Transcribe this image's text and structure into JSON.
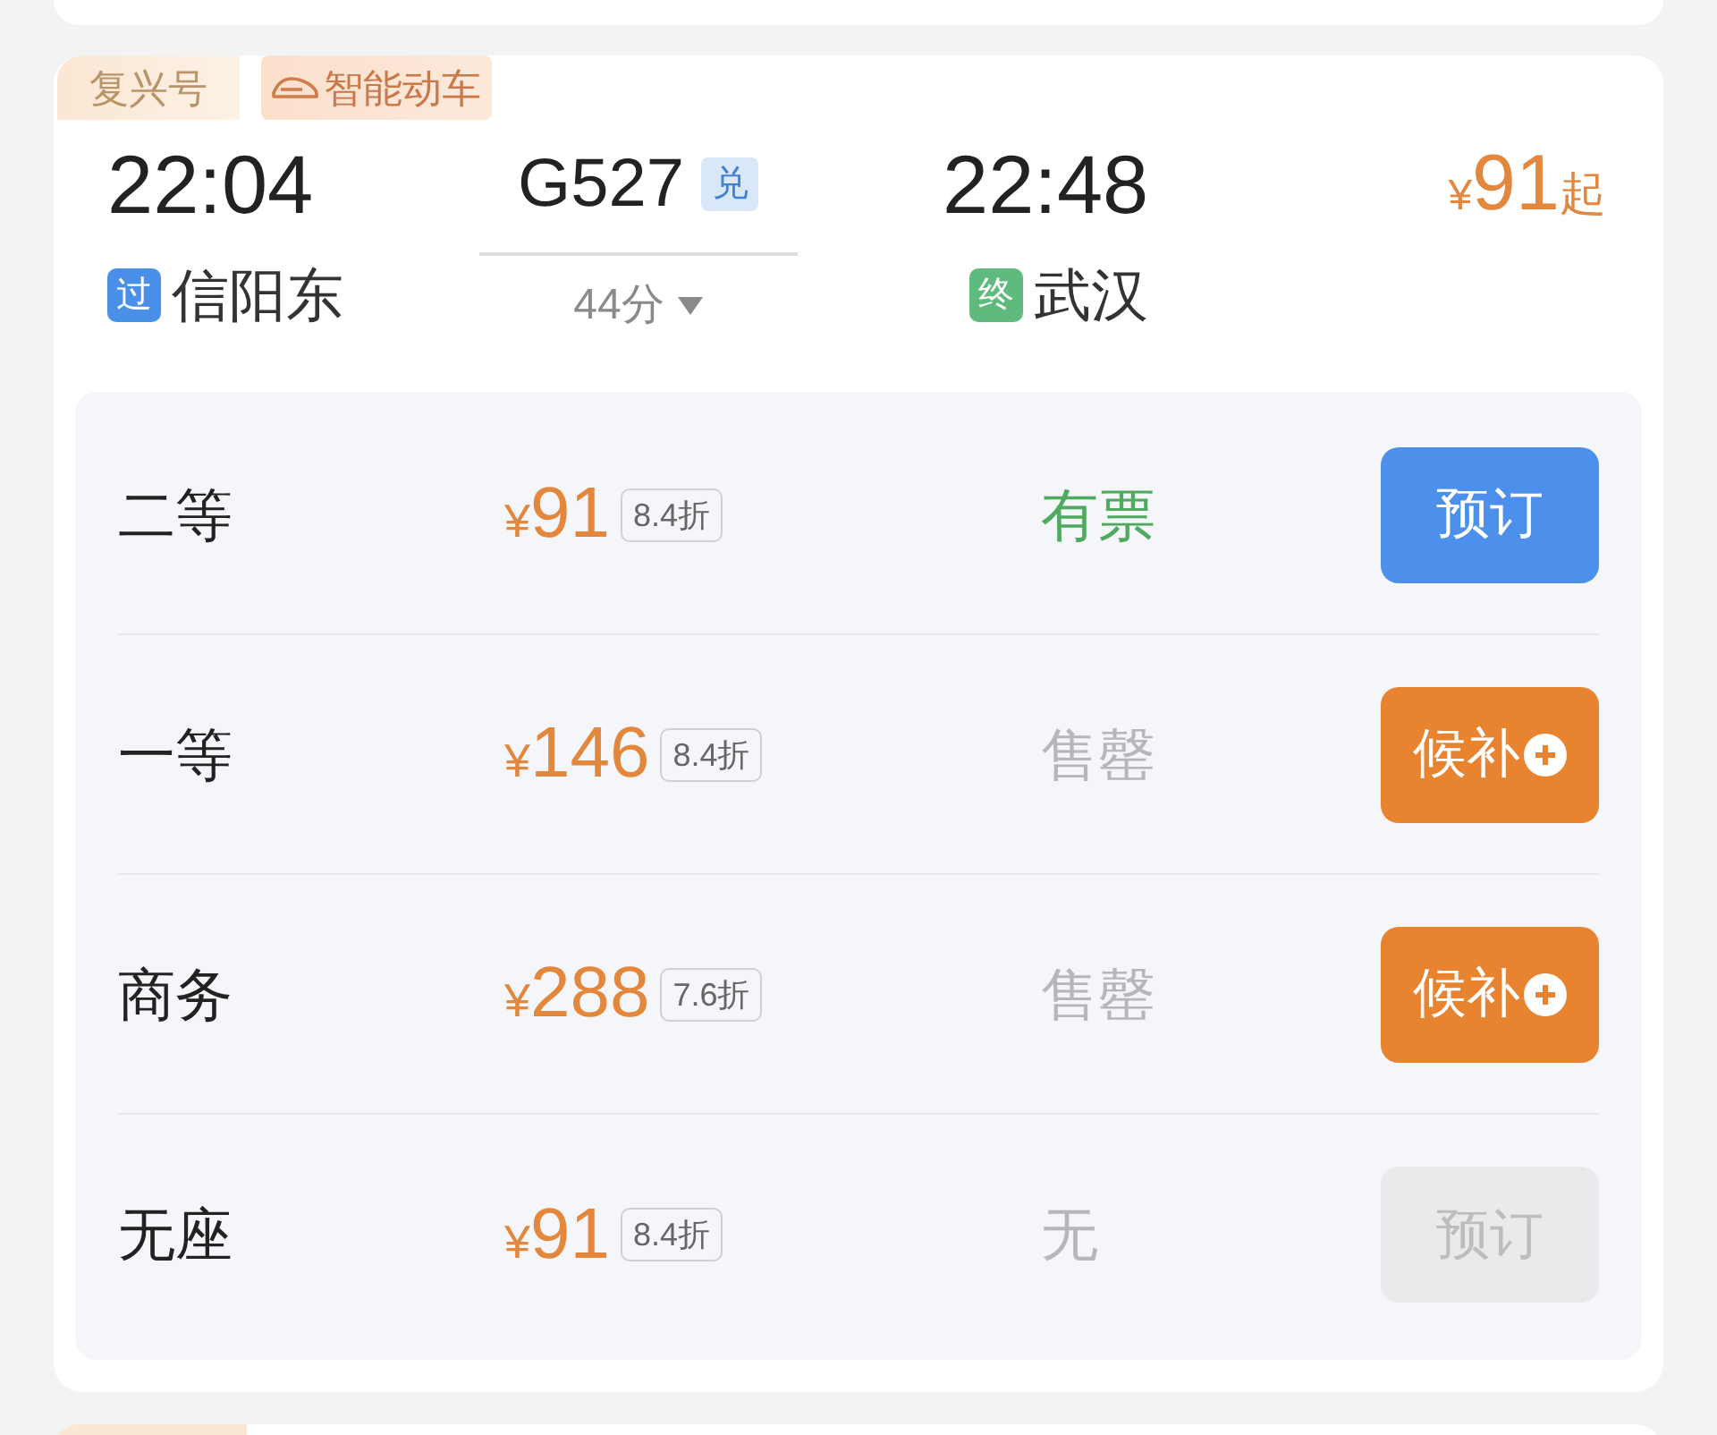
{
  "tags": [
    {
      "label": "复兴号",
      "kind": "plain"
    },
    {
      "label": "智能动车",
      "kind": "train"
    }
  ],
  "departure": {
    "time": "22:04",
    "station": "信阳东",
    "station_tag": {
      "label": "过",
      "kind": "pass"
    }
  },
  "train": {
    "number": "G527",
    "badge": "兑",
    "duration": "44分",
    "expanded": false
  },
  "arrival": {
    "time": "22:48",
    "station": "武汉",
    "station_tag": {
      "label": "终",
      "kind": "end"
    }
  },
  "lowest_price": {
    "currency": "¥",
    "amount": "91",
    "suffix": "起"
  },
  "seats": [
    {
      "class": "二等",
      "currency": "¥",
      "price": "91",
      "discount": "8.4折",
      "availability": "有票",
      "available": true,
      "action": {
        "label": "预订",
        "kind": "book",
        "disabled": false
      }
    },
    {
      "class": "一等",
      "currency": "¥",
      "price": "146",
      "discount": "8.4折",
      "availability": "售罄",
      "available": false,
      "action": {
        "label": "候补",
        "kind": "waitlist",
        "disabled": false
      }
    },
    {
      "class": "商务",
      "currency": "¥",
      "price": "288",
      "discount": "7.6折",
      "availability": "售罄",
      "available": false,
      "action": {
        "label": "候补",
        "kind": "waitlist",
        "disabled": false
      }
    },
    {
      "class": "无座",
      "currency": "¥",
      "price": "91",
      "discount": "8.4折",
      "availability": "无",
      "available": false,
      "action": {
        "label": "预订",
        "kind": "book",
        "disabled": true
      }
    }
  ]
}
